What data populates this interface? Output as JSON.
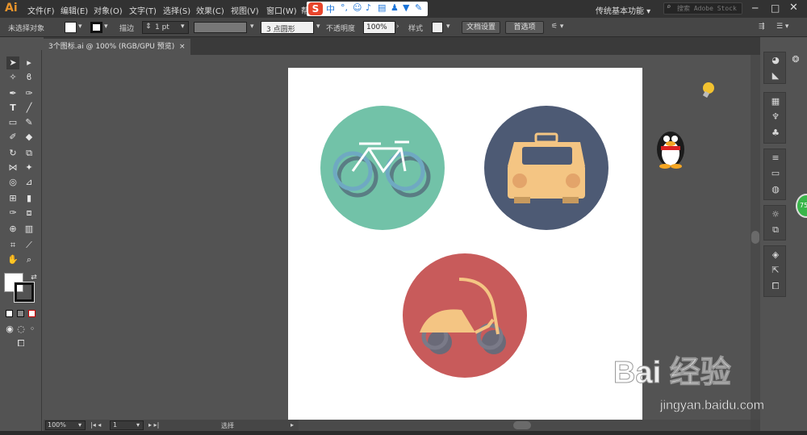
{
  "app": {
    "logo": "Ai",
    "workspace": "传统基本功能",
    "stock_search": "搜索 Adobe Stock"
  },
  "menu": [
    "文件(F)",
    "编辑(E)",
    "对象(O)",
    "文字(T)",
    "选择(S)",
    "效果(C)",
    "视图(V)",
    "窗口(W)",
    "帮"
  ],
  "ime": {
    "logo": "S",
    "lang": "中"
  },
  "control": {
    "selection": "未选择对象",
    "stroke_label": "描边",
    "stroke_value": "1 pt",
    "brush": "3 点圆形",
    "opacity_label": "不透明度",
    "opacity_value": "100%",
    "style_label": "样式",
    "doc_setup": "文档设置",
    "prefs": "首选项"
  },
  "tab": {
    "title": "3个图标.ai @ 100% (RGB/GPU 预览)",
    "close": "×"
  },
  "status": {
    "zoom": "100%",
    "page": "1",
    "mode": "选择"
  },
  "artwork": {
    "icons": [
      {
        "name": "bicycle",
        "bg": "#72c2a8"
      },
      {
        "name": "taxi",
        "bg": "#4d5a74"
      },
      {
        "name": "scooter",
        "bg": "#c85b5b"
      }
    ],
    "accent": "#f4c583"
  },
  "watermark": {
    "brand": "Bai 经验",
    "url": "jingyan.baidu.com"
  },
  "badge": "75"
}
